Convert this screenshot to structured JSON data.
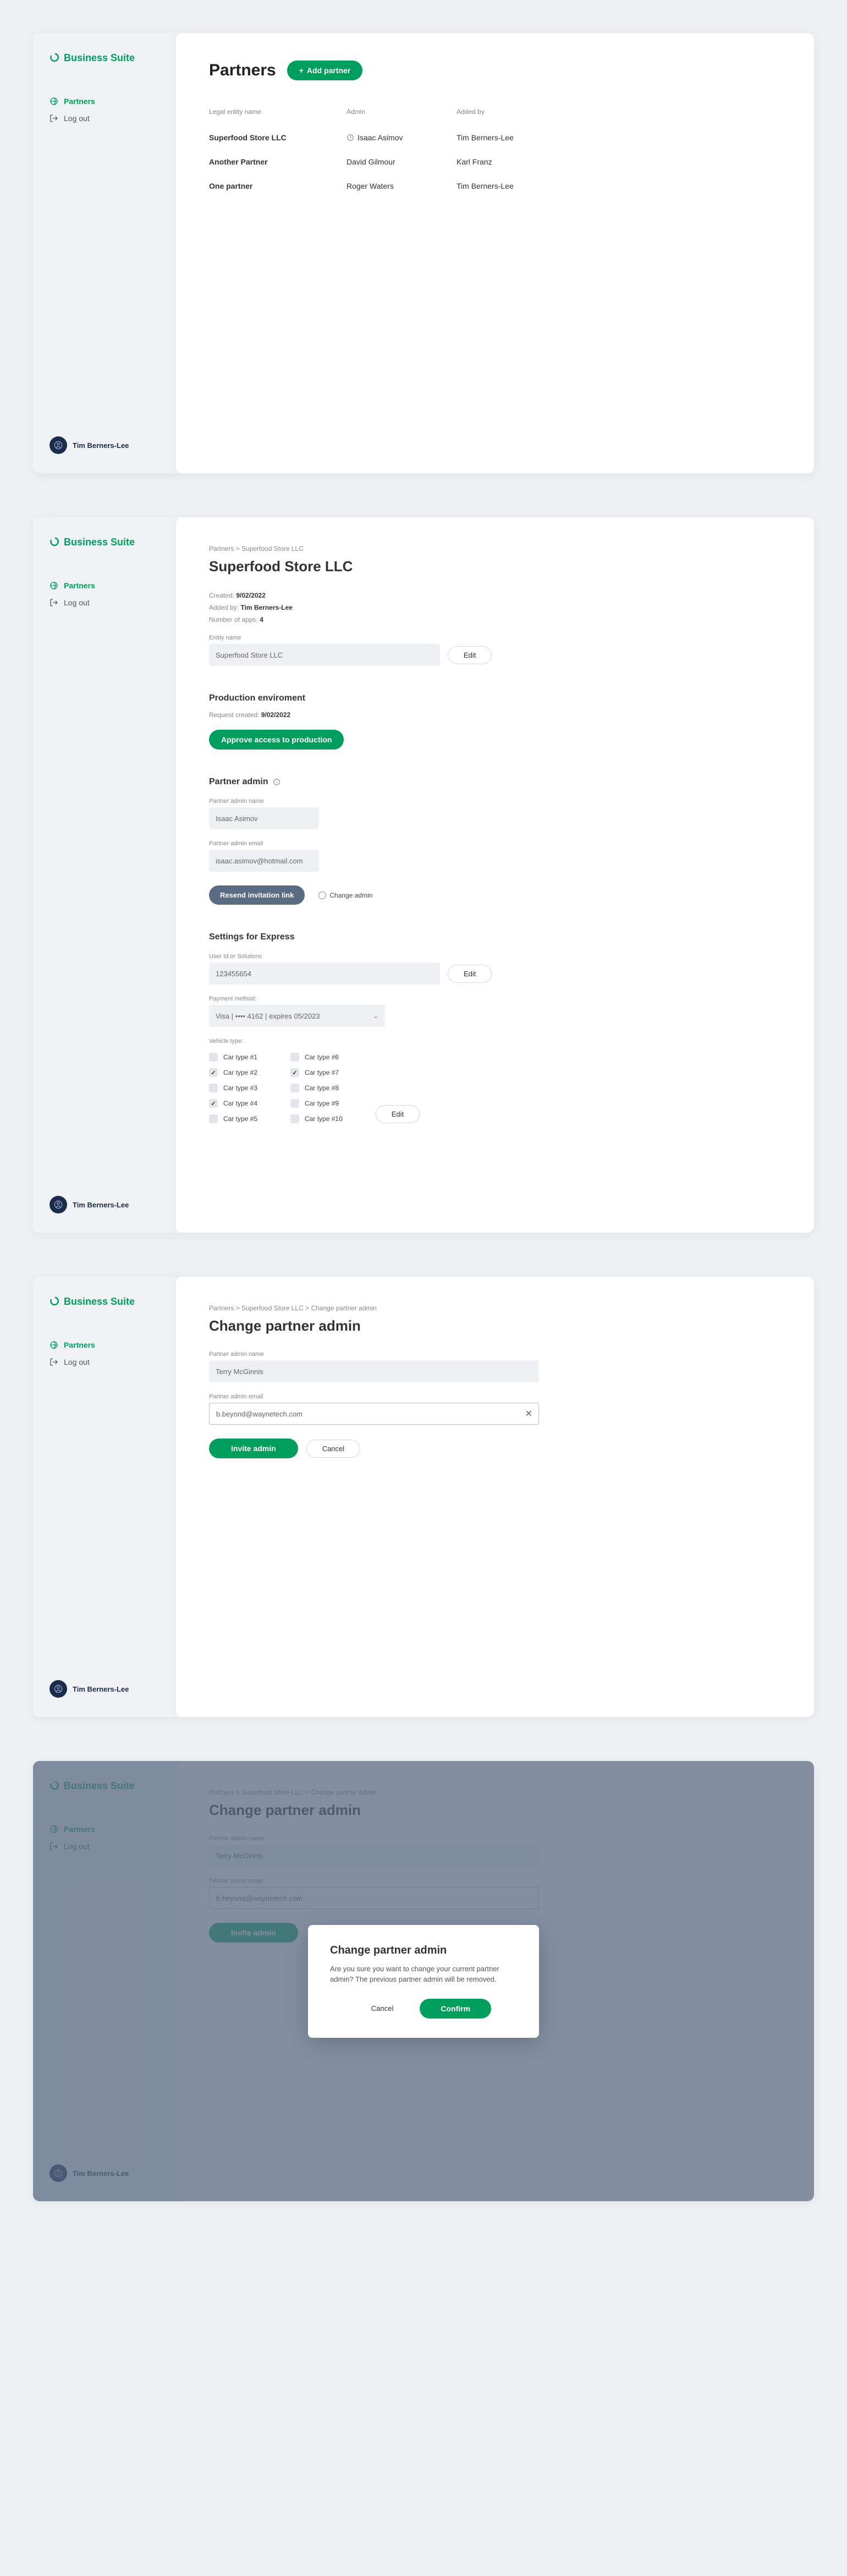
{
  "brand": "Business Suite",
  "nav": {
    "partners": "Partners",
    "logout": "Log out"
  },
  "user": {
    "name": "Tim Berners-Lee"
  },
  "screen1": {
    "title": "Partners",
    "add_btn": "Add partner",
    "cols": {
      "entity": "Legal entity name",
      "admin": "Admin",
      "added_by": "Added by"
    },
    "rows": [
      {
        "entity": "Superfood Store LLC",
        "admin": "Isaac Asimov",
        "added_by": "Tim Berners-Lee",
        "pending": true
      },
      {
        "entity": "Another Partner",
        "admin": "David Gilmour",
        "added_by": "Karl Franz",
        "pending": false
      },
      {
        "entity": "One partner",
        "admin": "Roger Waters",
        "added_by": "Tim Berners-Lee",
        "pending": false
      }
    ]
  },
  "screen2": {
    "breadcrumbs": "Partners > Superfood Store LLC",
    "title": "Superfood Store LLC",
    "created_label": "Created:",
    "created": "9/02/2022",
    "added_by_label": "Added by:",
    "added_by": "Tim Berners-Lee",
    "apps_label": "Number of apps:",
    "apps": "4",
    "entity_name_label": "Entity name",
    "entity_name": "Superfood Store LLC",
    "edit": "Edit",
    "prod_heading": "Production enviroment",
    "request_label": "Request created:",
    "request_date": "9/02/2022",
    "approve_btn": "Approve access to production",
    "admin_heading": "Partner admin",
    "admin_name_label": "Partner admin name",
    "admin_name": "Isaac Asimov",
    "admin_email_label": "Partner admin email",
    "admin_email": "isaac.asimov@hotmail.com",
    "resend_btn": "Resend invitation link",
    "change_admin_radio": "Change admin",
    "settings_heading": "Settings for Express",
    "user_id_label": "User Id or Solutionc",
    "user_id": "123455654",
    "payment_label": "Payment method:",
    "payment_value": "Visa | •••• 4162 | expires 05/2023",
    "vehicle_label": "Vehicle type:",
    "vehicles": [
      {
        "label": "Car type #1",
        "checked": false
      },
      {
        "label": "Car type #2",
        "checked": true
      },
      {
        "label": "Car type #3",
        "checked": false
      },
      {
        "label": "Car type #4",
        "checked": true
      },
      {
        "label": "Car type #5",
        "checked": false
      },
      {
        "label": "Car type #6",
        "checked": false
      },
      {
        "label": "Car type #7",
        "checked": true
      },
      {
        "label": "Car type #8",
        "checked": false
      },
      {
        "label": "Car type #9",
        "checked": false
      },
      {
        "label": "Car type #10",
        "checked": false
      }
    ]
  },
  "screen3": {
    "breadcrumbs": "Partners > Superfood Store LLC > Change partner admin",
    "title": "Change partner admin",
    "name_label": "Partner admin name",
    "name_value": "Terry McGinnis",
    "email_label": "Partner admin email",
    "email_value": "b.beyond@waynetech.com",
    "invite_btn": "Invite admin",
    "cancel_btn": "Cancel"
  },
  "screen4": {
    "modal_title": "Change partner admin",
    "modal_body": "Are you sure you want to change your current partner admin? The previous partner admin will be removed.",
    "cancel": "Cancel",
    "confirm": "Confirm"
  }
}
